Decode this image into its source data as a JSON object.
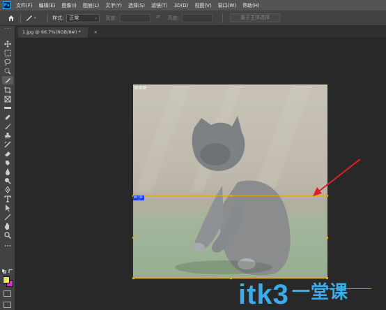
{
  "app": {
    "logo": "Ps"
  },
  "menu": [
    "文件(F)",
    "编辑(E)",
    "图像(I)",
    "图层(L)",
    "文字(Y)",
    "选择(S)",
    "滤镜(T)",
    "3D(D)",
    "视图(V)",
    "窗口(W)",
    "帮助(H)"
  ],
  "options_bar": {
    "style_label": "样式:",
    "style_value": "正常",
    "width_label": "宽度:",
    "height_label": "高度:",
    "select_subject_label": "基于主体选择"
  },
  "document_tab": {
    "title": "1.jpg @ 66.7%(RGB/8#) *",
    "close": "×"
  },
  "selection_info": [
    "W:",
    "H:"
  ],
  "colors": {
    "foreground": "#e9e85a",
    "background": "#c43bc2",
    "marquee": "#e0a525",
    "arrow": "#e02020",
    "watermark": "#3cabea"
  },
  "watermark": {
    "latin": "itk3",
    "cjk": "一堂课"
  },
  "tools": [
    "move-icon",
    "marquee-icon",
    "lasso-icon",
    "quick-select-icon",
    "crop-icon",
    "frame-icon",
    "eyedropper-icon",
    "healing-icon",
    "brush-icon",
    "stamp-icon",
    "history-brush-icon",
    "eraser-icon",
    "gradient-icon",
    "blur-icon",
    "dodge-icon",
    "pen-icon",
    "type-icon",
    "path-select-icon",
    "rectangle-icon",
    "hand-icon",
    "zoom-icon",
    "more-icon"
  ]
}
